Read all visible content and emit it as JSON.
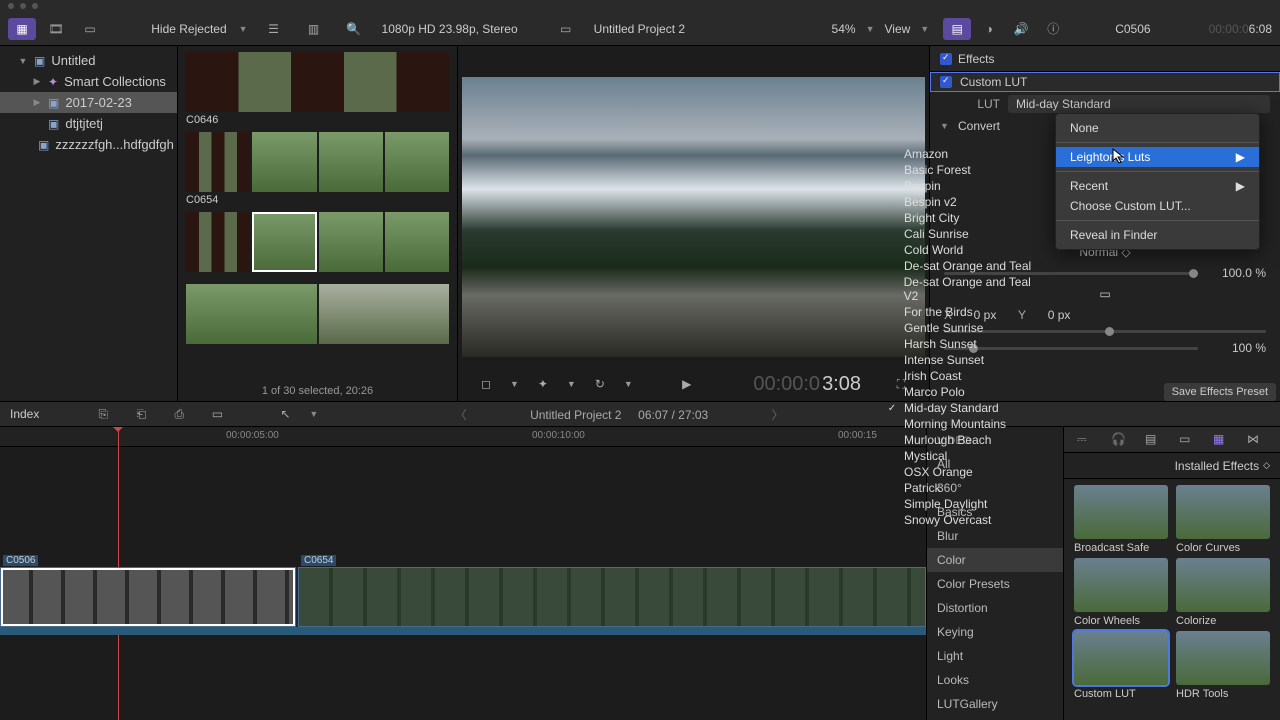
{
  "toolbar": {
    "hide_rejected": "Hide Rejected",
    "format": "1080p HD 23.98p, Stereo",
    "project": "Untitled Project 2",
    "zoom": "54%",
    "view": "View",
    "clip_name": "C0506",
    "timecode_gray": "00:00:0",
    "timecode_cur": "6:08"
  },
  "sidebar": {
    "items": [
      {
        "label": "Untitled",
        "depth": 1,
        "icon": "folder",
        "tri": "▼"
      },
      {
        "label": "Smart Collections",
        "depth": 2,
        "icon": "star",
        "tri": "▶"
      },
      {
        "label": "2017-02-23",
        "depth": 2,
        "icon": "folder",
        "tri": "▶",
        "sel": true
      },
      {
        "label": "dtjtjtetj",
        "depth": 2,
        "icon": "folder"
      },
      {
        "label": "zzzzzzfgh...hdfgdfgh",
        "depth": 2,
        "icon": "folder"
      }
    ]
  },
  "browser": {
    "clip1": "C0646",
    "clip2": "C0654",
    "footer": "1 of 30 selected, 20:26"
  },
  "viewer": {
    "time_gray": "00:00:0",
    "time_cur": "3:08"
  },
  "inspector": {
    "effects": "Effects",
    "custom_lut": "Custom LUT",
    "lut_label": "LUT",
    "lut_value": "Mid-day Standard",
    "convert": "Convert",
    "normal": "Normal",
    "mix": "100.0 %",
    "x_lbl": "X",
    "x_val": "0 px",
    "y_lbl": "Y",
    "y_val": "0 px",
    "scale": "100 %",
    "save_preset": "Save Effects Preset"
  },
  "lut_submenu": {
    "none": "None",
    "leighton": "Leighton's Luts",
    "recent": "Recent",
    "choose": "Choose Custom LUT...",
    "reveal": "Reveal in Finder"
  },
  "lut_list": [
    "Amazon",
    "Basic Forest",
    "Bespin",
    "Bespin v2",
    "Bright City",
    "Cali Sunrise",
    "Cold World",
    "De-sat Orange and Teal",
    "De-sat Orange and Teal V2",
    "For the Birds",
    "Gentle Sunrise",
    "Harsh Sunset",
    "Intense Sunset",
    "Irish Coast",
    "Marco Polo",
    "Mid-day Standard",
    "Morning Mountains",
    "Murlough Beach",
    "Mystical",
    "OSX Orange",
    "Patrick",
    "Simple Daylight",
    "Snowy Overcast"
  ],
  "lut_selected_index": 15,
  "middle": {
    "index": "Index",
    "project": "Untitled Project 2",
    "time": "06:07 / 27:03"
  },
  "ruler": {
    "t1": "00:00:05:00",
    "t2": "00:00:10:00",
    "t3": "00:00:15"
  },
  "clips": {
    "c1": "C0506",
    "c2": "C0654"
  },
  "categories": {
    "head": "VIDEO",
    "items": [
      "All",
      "360°",
      "Basics",
      "Blur",
      "Color",
      "Color Presets",
      "Distortion",
      "Keying",
      "Light",
      "Looks",
      "LUTGallery"
    ],
    "sel": "Color"
  },
  "fx": {
    "installed": "Installed Effects",
    "items": [
      "Broadcast Safe",
      "Color Curves",
      "Color Wheels",
      "Colorize",
      "Custom LUT",
      "HDR Tools"
    ],
    "sel": "Custom LUT"
  }
}
